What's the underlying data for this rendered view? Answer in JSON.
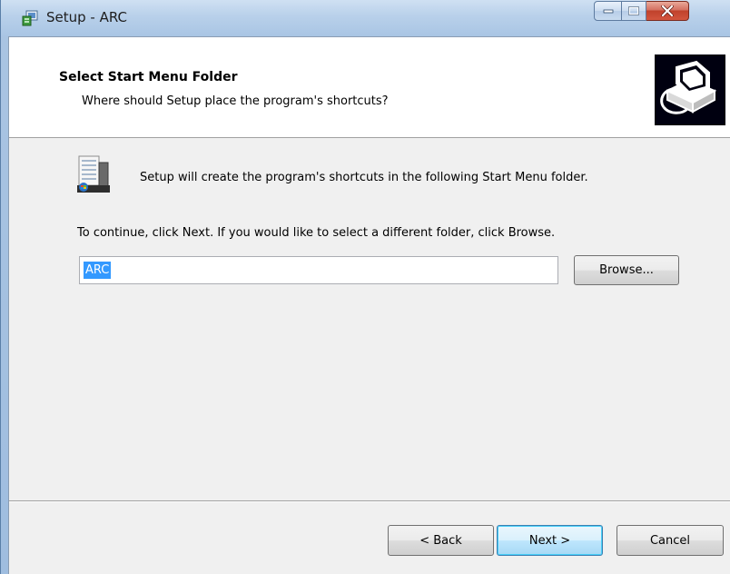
{
  "window": {
    "title": "Setup - ARC"
  },
  "header": {
    "title": "Select Start Menu Folder",
    "subtitle": "Where should Setup place the program's shortcuts?"
  },
  "body": {
    "info_text": "Setup will create the program's shortcuts in the following Start Menu folder.",
    "instructions_text": "To continue, click Next. If you would like to select a different folder, click Browse.",
    "folder_value": "ARC",
    "browse_label": "Browse..."
  },
  "footer": {
    "back_label": "< Back",
    "next_label": "Next >",
    "cancel_label": "Cancel"
  },
  "icons": {
    "app": "setup-installer-icon",
    "header_image": "computer-install-icon",
    "folder": "start-menu-folder-icon",
    "minimize": "minimize-icon",
    "maximize": "maximize-icon",
    "close": "close-icon"
  },
  "colors": {
    "title_bar": "#b9d1ea",
    "close_button": "#c0412b",
    "selection": "#3399ff",
    "next_button_border": "#3c7fb1"
  }
}
